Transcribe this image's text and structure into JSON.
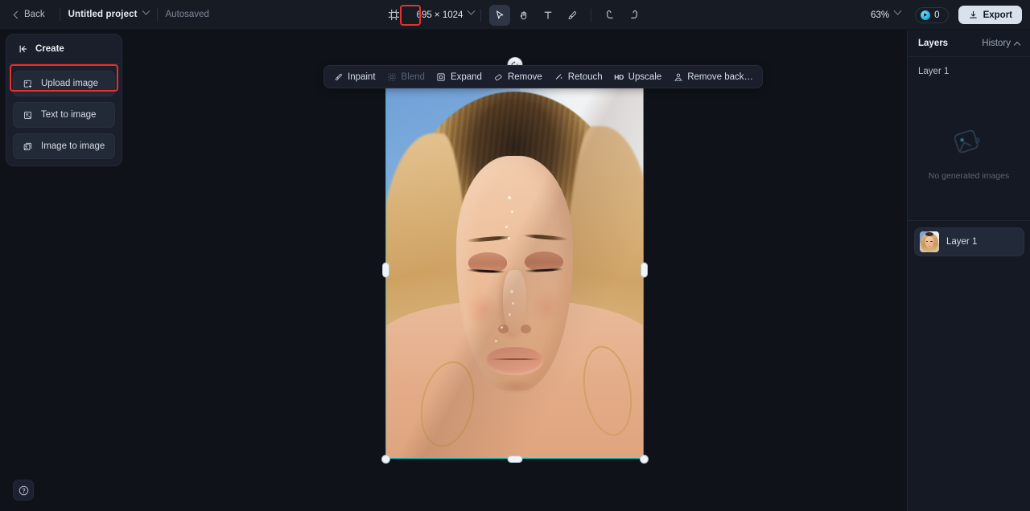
{
  "topbar": {
    "back_label": "Back",
    "project_name": "Untitled project",
    "autosave_status": "Autosaved",
    "frame_size": "695 × 1024",
    "zoom_level": "63%",
    "credits_count": "0",
    "export_label": "Export",
    "tools": [
      {
        "name": "select-tool",
        "icon": "cursor-arrow-icon",
        "active": true
      },
      {
        "name": "hand-tool",
        "icon": "hand-icon",
        "active": false
      },
      {
        "name": "text-tool",
        "icon": "text-t-icon",
        "active": false
      },
      {
        "name": "brush-tool",
        "icon": "brush-icon",
        "active": false
      },
      {
        "name": "undo-button",
        "icon": "undo-arrow-icon",
        "active": false
      },
      {
        "name": "redo-button",
        "icon": "redo-arrow-icon",
        "active": false
      }
    ]
  },
  "left_panel": {
    "title": "Create",
    "items": [
      {
        "label": "Upload image",
        "icon": "upload-image-icon",
        "highlighted": true
      },
      {
        "label": "Text to image",
        "icon": "text-to-image-icon",
        "highlighted": false
      },
      {
        "label": "Image to image",
        "icon": "image-to-image-icon",
        "highlighted": false
      }
    ]
  },
  "action_bar": {
    "items": [
      {
        "label": "Inpaint",
        "icon": "inpaint-icon",
        "disabled": false
      },
      {
        "label": "Blend",
        "icon": "blend-icon",
        "disabled": true
      },
      {
        "label": "Expand",
        "icon": "expand-icon",
        "disabled": false
      },
      {
        "label": "Remove",
        "icon": "remove-eraser-icon",
        "disabled": false
      },
      {
        "label": "Retouch",
        "icon": "retouch-icon",
        "disabled": false
      },
      {
        "label": "Upscale",
        "icon": "hd-icon",
        "disabled": false
      },
      {
        "label": "Remove back…",
        "icon": "remove-background-icon",
        "disabled": false
      }
    ]
  },
  "right_panel": {
    "tab_layers": "Layers",
    "tab_history": "History",
    "section_label": "Layer 1",
    "empty_message": "No generated images",
    "layers": [
      {
        "name": "Layer 1"
      }
    ]
  },
  "canvas": {
    "help_label": "?",
    "selection_color": "#18bcbc"
  }
}
